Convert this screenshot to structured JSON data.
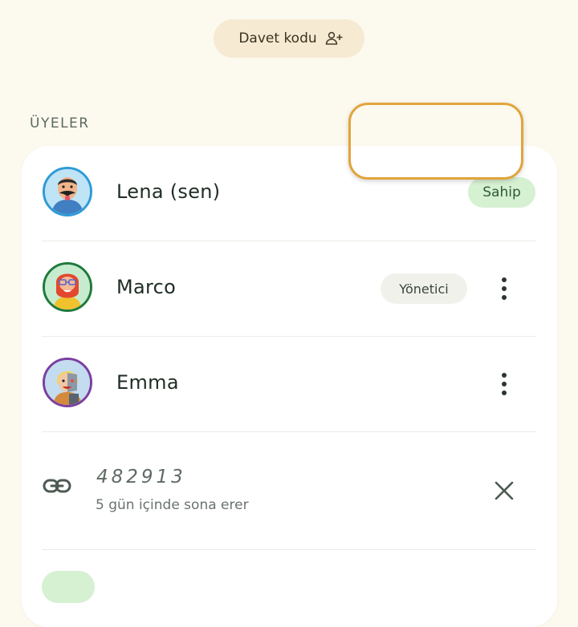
{
  "invite_button": {
    "label": "Davet kodu",
    "icon": "person-add-icon"
  },
  "members_section": {
    "label": "ÜYELER"
  },
  "members": [
    {
      "name": "Lena (sen)",
      "role": "Sahip",
      "avatar_ring": "#2e9bd6"
    },
    {
      "name": "Marco",
      "role": "Yönetici",
      "avatar_ring": "#1f7a3c",
      "menu_icon": "more-vertical-icon"
    },
    {
      "name": "Emma",
      "avatar_ring": "#7b3fa0",
      "menu_icon": "more-vertical-icon"
    }
  ],
  "invite_code": {
    "code": "482913",
    "expiry": "5 gün içinde sona erer",
    "link_icon": "link-icon",
    "remove_icon": "close-icon"
  },
  "colors": {
    "background": "#fcf9ef",
    "owner_badge": "#d6f0d2",
    "highlight": "#e2a43b"
  }
}
